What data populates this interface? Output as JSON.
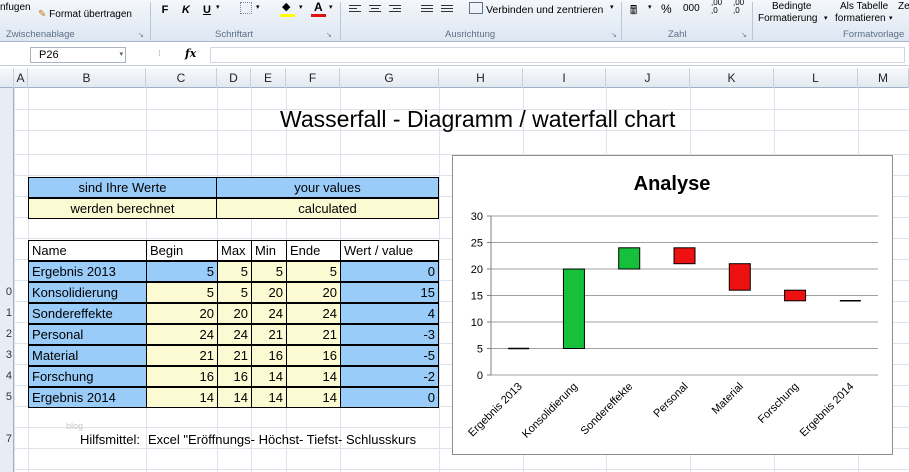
{
  "ribbon": {
    "paste_partial": "nfugen",
    "format_painter": "Format übertragen",
    "bold": "F",
    "italic": "K",
    "underline": "U",
    "merge_center": "Verbinden und zentrieren",
    "percent": "%",
    "thousands": "000",
    "decimal_increase": ",00\n,0",
    "cond_format_line1": "Bedingte",
    "cond_format_line2": "Formatierung",
    "as_table_line1": "Als Tabelle",
    "as_table_line2": "formatieren",
    "cell_styles_partial": "Ze",
    "groups": {
      "clipboard": "Zwischenablage",
      "font": "Schriftart",
      "alignment": "Ausrichtung",
      "number": "Zahl",
      "styles_partial": "Formatvorlage"
    }
  },
  "formula_bar": {
    "name_box": "P26",
    "fx": "fx",
    "content": ""
  },
  "columns": [
    "A",
    "B",
    "C",
    "D",
    "E",
    "F",
    "G",
    "H",
    "I",
    "J",
    "K",
    "L",
    "M"
  ],
  "row_numbers": [
    "",
    "",
    "",
    "",
    "",
    "",
    "",
    "",
    "",
    "0",
    "1",
    "2",
    "3",
    "4",
    "5",
    "",
    "7",
    ""
  ],
  "sheet_title": "Wasserfall - Diagramm / waterfall chart",
  "legend_table": {
    "row1": [
      "sind Ihre Werte",
      "your values"
    ],
    "row2": [
      "werden berechnet",
      "calculated"
    ]
  },
  "data_table": {
    "headers": [
      "Name",
      "Begin",
      "Max",
      "Min",
      "Ende",
      "Wert / value"
    ],
    "rows": [
      [
        "Ergebnis 2013",
        "5",
        "5",
        "5",
        "5",
        "0"
      ],
      [
        "Konsolidierung",
        "5",
        "5",
        "20",
        "20",
        "15"
      ],
      [
        "Sondereffekte",
        "20",
        "20",
        "24",
        "24",
        "4"
      ],
      [
        "Personal",
        "24",
        "24",
        "21",
        "21",
        "-3"
      ],
      [
        "Material",
        "21",
        "21",
        "16",
        "16",
        "-5"
      ],
      [
        "Forschung",
        "16",
        "16",
        "14",
        "14",
        "-2"
      ],
      [
        "Ergebnis 2014",
        "14",
        "14",
        "14",
        "14",
        "0"
      ]
    ]
  },
  "footer": {
    "blog_watermark": "blog",
    "hilfsmittel_label": "Hilfsmittel:",
    "hilfsmittel_value": "Excel \"Eröffnungs- Höchst- Tiefst- Schlusskurs"
  },
  "colors": {
    "increase": "#17c03b",
    "decrease": "#ee1111",
    "blue_cell": "#99ccf9",
    "cream_cell": "#fbfad3"
  },
  "chart_data": {
    "type": "bar",
    "title": "Analyse",
    "xlabel": "",
    "ylabel": "",
    "ylim": [
      0,
      30
    ],
    "yticks": [
      0,
      5,
      10,
      15,
      20,
      25,
      30
    ],
    "grid": true,
    "categories": [
      "Ergebnis 2013",
      "Konsolidierung",
      "Sondereffekte",
      "Personal",
      "Material",
      "Forschung",
      "Ergebnis 2014"
    ],
    "series": [
      {
        "values": [
          {
            "open": 5,
            "close": 5
          },
          {
            "open": 5,
            "close": 20
          },
          {
            "open": 20,
            "close": 24
          },
          {
            "open": 24,
            "close": 21
          },
          {
            "open": 21,
            "close": 16
          },
          {
            "open": 16,
            "close": 14
          },
          {
            "open": 14,
            "close": 14
          }
        ]
      }
    ]
  }
}
